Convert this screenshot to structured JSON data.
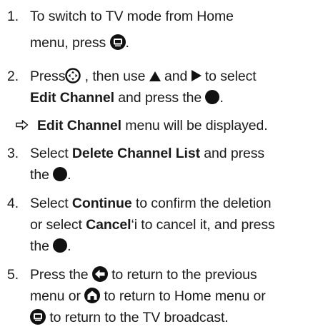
{
  "steps": [
    {
      "num": "1.",
      "l1a": "To switch to TV mode from Home",
      "l2a": "menu, press "
    },
    {
      "num": "2.",
      "l1a": "Press",
      "l1b": " , then use ",
      "l1c": " and ",
      "l1d": " to select",
      "l2bold": "Edit Channel",
      "l2a": " and press the ",
      "l2b": "."
    },
    {
      "result_bold": "Edit Channel",
      "result_text": " menu will be displayed."
    },
    {
      "num": "3.",
      "l1a": "Select ",
      "l1bold": "Delete Channel List",
      "l1b": " and press",
      "l2a": "the ",
      "l2b": "."
    },
    {
      "num": "4.",
      "l1a": "Select ",
      "l1bold": "Continue",
      "l1b": " to confirm the deletion",
      "l2a": "or select ",
      "l2bold": "Cancel",
      "l2b": "‘i to cancel it, and press",
      "l3a": "the ",
      "l3b": "."
    },
    {
      "num": "5.",
      "l1a": "Press the ",
      "l1b": " to return to the previous",
      "l2a": "menu or ",
      "l2b": " to return to Home menu or",
      "l3a": " to return to the TV broadcast."
    }
  ],
  "icons": {
    "tv": "tv-button-icon",
    "dpad": "navigation-pad-icon",
    "up": "up-triangle-icon",
    "right": "right-triangle-icon",
    "ok": "ok-button-icon",
    "back": "back-arrow-icon",
    "home": "home-icon",
    "result": "result-arrow-icon"
  }
}
